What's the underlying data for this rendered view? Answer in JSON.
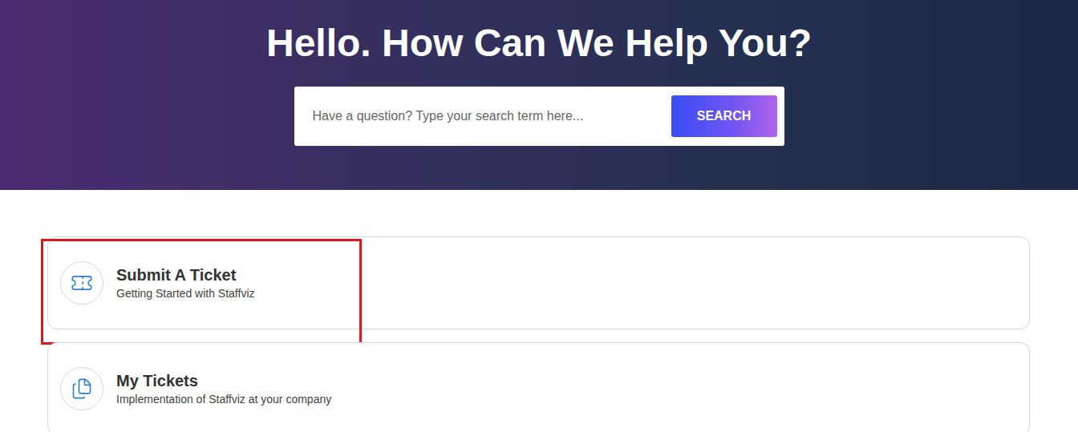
{
  "hero": {
    "title": "Hello. How Can We Help You?",
    "search": {
      "placeholder": "Have a question? Type your search term here...",
      "button": "SEARCH"
    }
  },
  "cards": [
    {
      "title": "Submit A Ticket",
      "subtitle": "Getting Started with Staffviz",
      "highlighted": true
    },
    {
      "title": "My Tickets",
      "subtitle": "Implementation of Staffviz at your company",
      "highlighted": false
    }
  ]
}
